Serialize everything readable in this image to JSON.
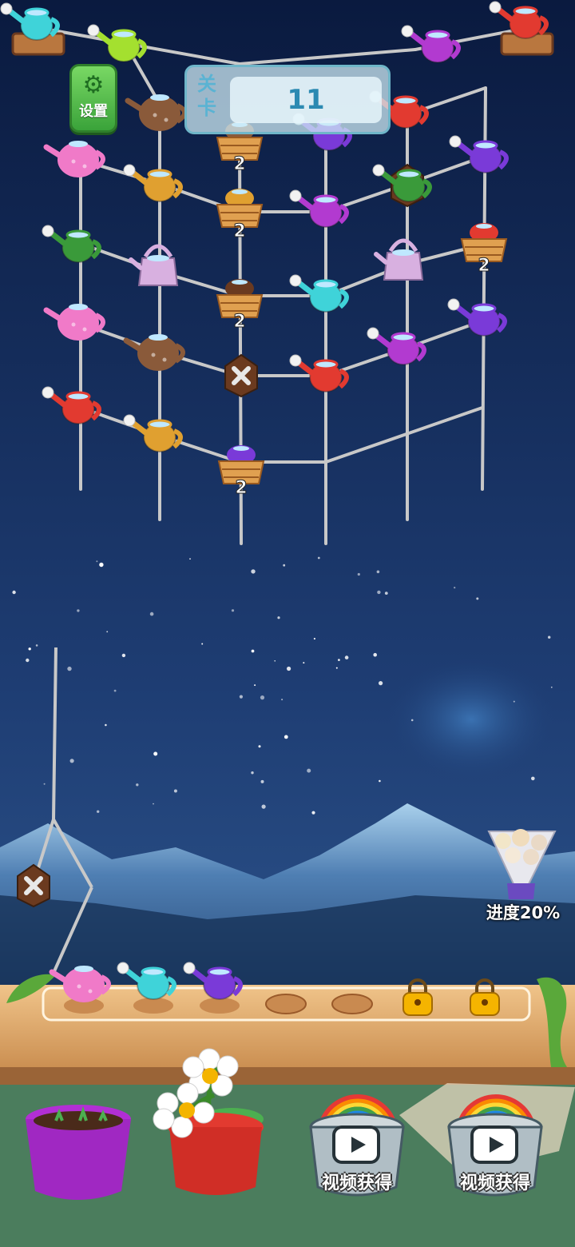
{
  "hud": {
    "settings_label": "设置",
    "level_label": "关卡",
    "level_number": "11"
  },
  "board": {
    "basket_count": "2",
    "items": [
      {
        "kind": "can",
        "color": "#3fd3d9"
      },
      {
        "kind": "can",
        "color": "#a4e02f"
      },
      {
        "kind": "can",
        "color": "#b23ad0"
      },
      {
        "kind": "can",
        "color": "#e23a30"
      },
      {
        "kind": "pot",
        "color": "#8a5a3a"
      },
      {
        "kind": "pot",
        "color": "#f07ac8"
      },
      {
        "kind": "can",
        "color": "#e0a030"
      },
      {
        "kind": "basket",
        "color": "#e0a030"
      },
      {
        "kind": "can",
        "color": "#b23ad0"
      },
      {
        "kind": "locked",
        "color": "#6b3a1f"
      },
      {
        "kind": "can",
        "color": "#3a9a3a"
      },
      {
        "kind": "basket",
        "color": "#e23a30"
      },
      {
        "kind": "can",
        "color": "#7a3ad8"
      },
      {
        "kind": "kettle",
        "color": "#d8b0e0"
      },
      {
        "kind": "basket",
        "color": "#6a3a20"
      },
      {
        "kind": "can",
        "color": "#3fd3d9"
      },
      {
        "kind": "kettle",
        "color": "#d8b0e0"
      },
      {
        "kind": "pot",
        "color": "#f07ac8"
      },
      {
        "kind": "locked",
        "color": "#6b3a1f"
      },
      {
        "kind": "can",
        "color": "#e23a30"
      },
      {
        "kind": "can",
        "color": "#b23ad0"
      },
      {
        "kind": "can",
        "color": "#7a3ad8"
      },
      {
        "kind": "pot",
        "color": "#8a5a3a"
      },
      {
        "kind": "can",
        "color": "#e23a30"
      },
      {
        "kind": "can",
        "color": "#e0a030"
      },
      {
        "kind": "basket",
        "color": "#7a3ad8"
      },
      {
        "kind": "can",
        "color": "#e23a30"
      },
      {
        "kind": "can",
        "color": "#3a9a3a"
      },
      {
        "kind": "basket",
        "color": "#8a5a3a"
      },
      {
        "kind": "can",
        "color": "#7a3ad8"
      }
    ]
  },
  "hook": {
    "kind": "locked",
    "color": "#6b3a1f"
  },
  "progress": {
    "label": "进度20%",
    "value_percent": 20
  },
  "tray": {
    "slots": [
      {
        "state": "filled",
        "kind": "pot",
        "color": "#f07ac8"
      },
      {
        "state": "filled",
        "kind": "can",
        "color": "#3fd3d9"
      },
      {
        "state": "filled",
        "kind": "can",
        "color": "#7a3ad8"
      },
      {
        "state": "empty"
      },
      {
        "state": "empty"
      },
      {
        "state": "locked"
      },
      {
        "state": "locked"
      }
    ]
  },
  "bottom": {
    "video_button_1": "视频获得",
    "video_button_2": "视频获得",
    "pot_purple_color": "#b22fd4",
    "pot_red_color": "#e23a30"
  },
  "colors": {
    "sky_top": "#0b1d45",
    "sky_bottom": "#2a4e86",
    "rope": "#c9c9c9",
    "wood": "#e6b57a",
    "settings_green": "#4cb848"
  }
}
